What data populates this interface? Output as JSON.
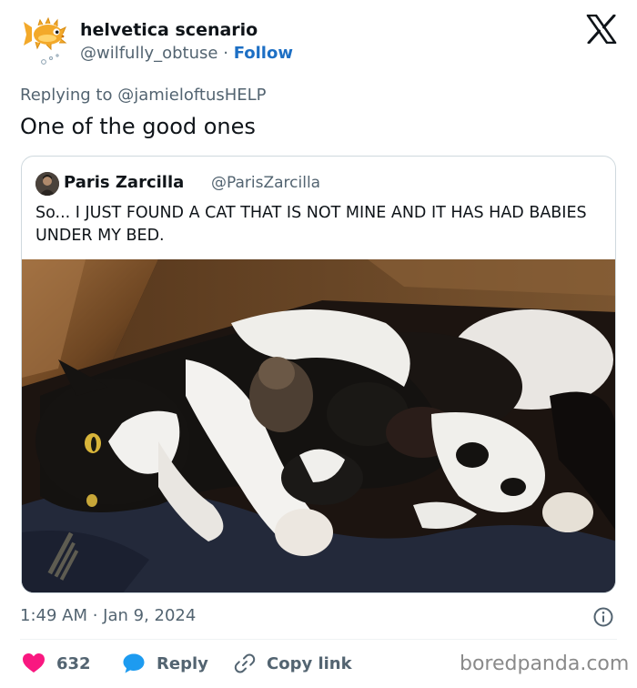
{
  "author": {
    "display_name": "helvetica scenario",
    "handle": "@wilfully_obtuse",
    "separator": "·",
    "follow_label": "Follow"
  },
  "reply_context": {
    "prefix": "Replying to",
    "handle": "@jamieloftusHELP"
  },
  "tweet_text": "One of the good ones",
  "quoted": {
    "display_name": "Paris Zarcilla",
    "handle": "@ParisZarcilla",
    "text": "So... I JUST FOUND A CAT THAT IS NOT MINE AND IT HAS HAD BABIES UNDER MY BED."
  },
  "meta": {
    "timestamp": "1:49 AM · Jan 9, 2024"
  },
  "actions": {
    "like_count": "632",
    "reply_label": "Reply",
    "copy_label": "Copy link"
  },
  "watermark": "boredpanda.com",
  "icons": {
    "avatar": "pufferfish-icon",
    "brand": "x-logo-icon",
    "info": "info-icon",
    "like": "heart-icon",
    "reply": "speech-bubble-icon",
    "copy": "link-icon"
  },
  "colors": {
    "text": "#0f1419",
    "secondary": "#536471",
    "follow": "#1d6fc4",
    "like": "#f91880",
    "reply": "#1d9bf0",
    "border": "#cfd9de"
  }
}
